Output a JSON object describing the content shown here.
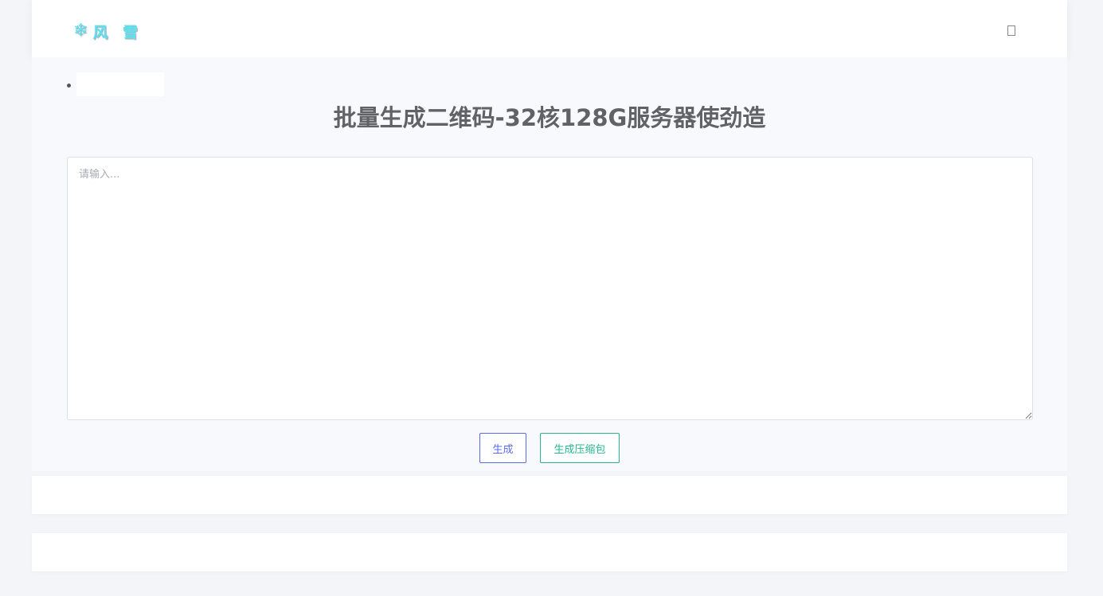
{
  "header": {
    "logo_icon": "snowflake-icon",
    "logo_glyph": "❄",
    "logo_text": "风 雪",
    "logo_color": "#5fe3f0",
    "menu_icon": "menu-toggle-icon"
  },
  "main": {
    "title": "批量生成二维码-32核128G服务器使劲造",
    "input": {
      "placeholder": "请输入...",
      "value": ""
    },
    "buttons": {
      "generate_label": "生成",
      "zip_label": "生成压缩包"
    }
  },
  "colors": {
    "generate_accent": "#5b6be8",
    "zip_accent": "#27b78f",
    "title": "#606266"
  }
}
